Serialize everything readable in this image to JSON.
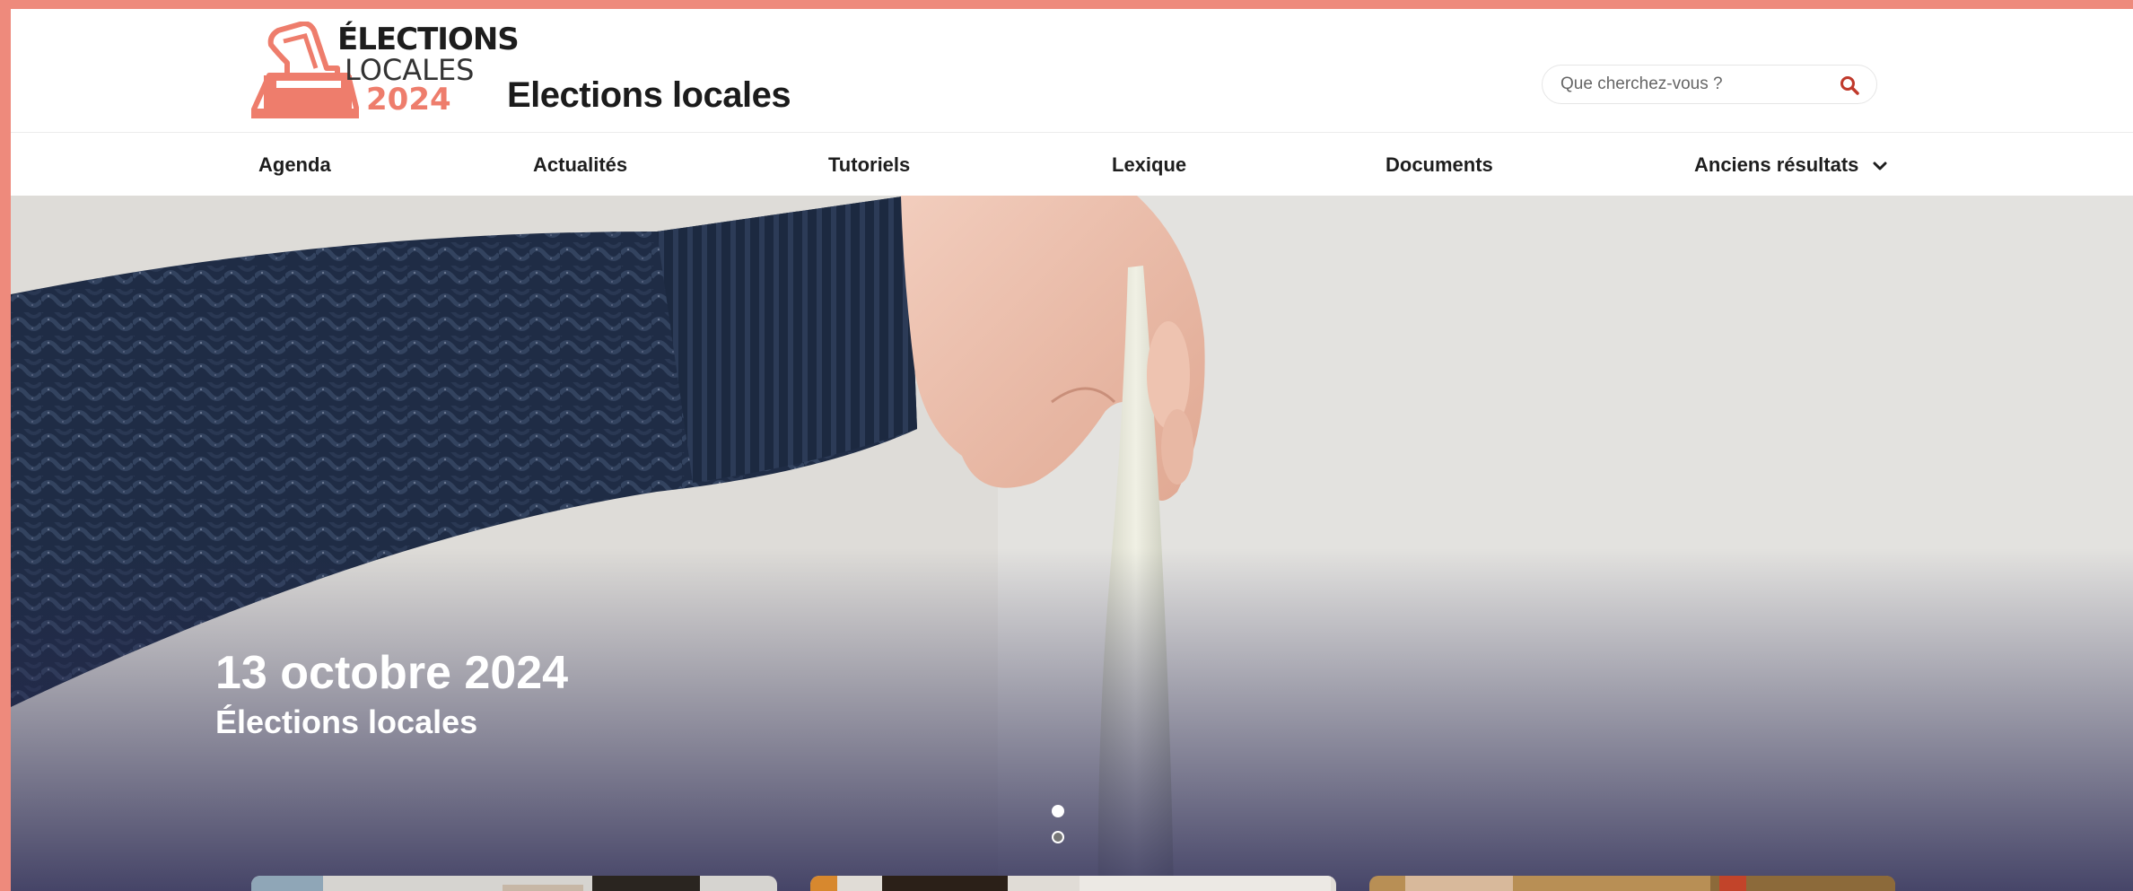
{
  "header": {
    "logo": {
      "line1": "ÉLECTIONS",
      "line2": "LOCALES",
      "line3": "2024",
      "icon": "ballot-box-icon"
    },
    "site_title": "Elections locales",
    "search": {
      "placeholder": "Que cherchez-vous ?",
      "value": "",
      "icon": "search-icon"
    }
  },
  "nav": {
    "items": [
      {
        "label": "Agenda"
      },
      {
        "label": "Actualités"
      },
      {
        "label": "Tutoriels"
      },
      {
        "label": "Lexique"
      },
      {
        "label": "Documents"
      },
      {
        "label": "Anciens résultats",
        "icon": "chevron-down-icon"
      }
    ]
  },
  "hero": {
    "date": "13 octobre 2024",
    "subtitle": "Élections locales",
    "slides": 2,
    "active_slide": 1
  },
  "colors": {
    "accent": "#ee7d6c",
    "frame": "#ee8a7c",
    "text": "#1e1e1e",
    "hero_bottom": "#2d2c55"
  }
}
